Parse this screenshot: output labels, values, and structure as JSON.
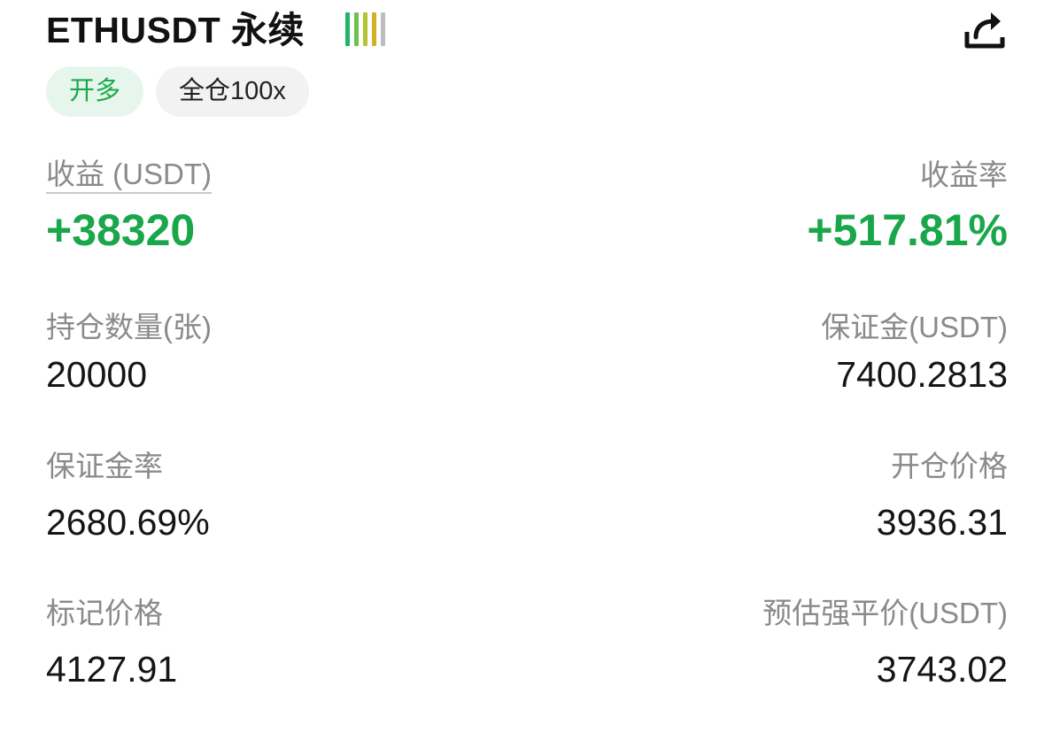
{
  "header": {
    "title": "ETHUSDT 永续",
    "signal_colors": [
      "#21b36a",
      "#6cc24a",
      "#b5c52d",
      "#d4b026",
      "#bdbdbd"
    ],
    "share_icon": "share-icon"
  },
  "tags": {
    "direction": "开多",
    "margin_mode": "全仓100x"
  },
  "pnl": {
    "label": "收益 (USDT)",
    "value": "+38320",
    "rate_label": "收益率",
    "rate_value": "+517.81%",
    "positive_color": "#1aa64a"
  },
  "stats": {
    "position_size_label": "持仓数量(张)",
    "position_size_value": "20000",
    "margin_label": "保证金(USDT)",
    "margin_value": "7400.2813",
    "margin_ratio_label": "保证金率",
    "margin_ratio_value": "2680.69%",
    "entry_price_label": "开仓价格",
    "entry_price_value": "3936.31",
    "mark_price_label": "标记价格",
    "mark_price_value": "4127.91",
    "liq_price_label": "预估强平价(USDT)",
    "liq_price_value": "3743.02"
  }
}
